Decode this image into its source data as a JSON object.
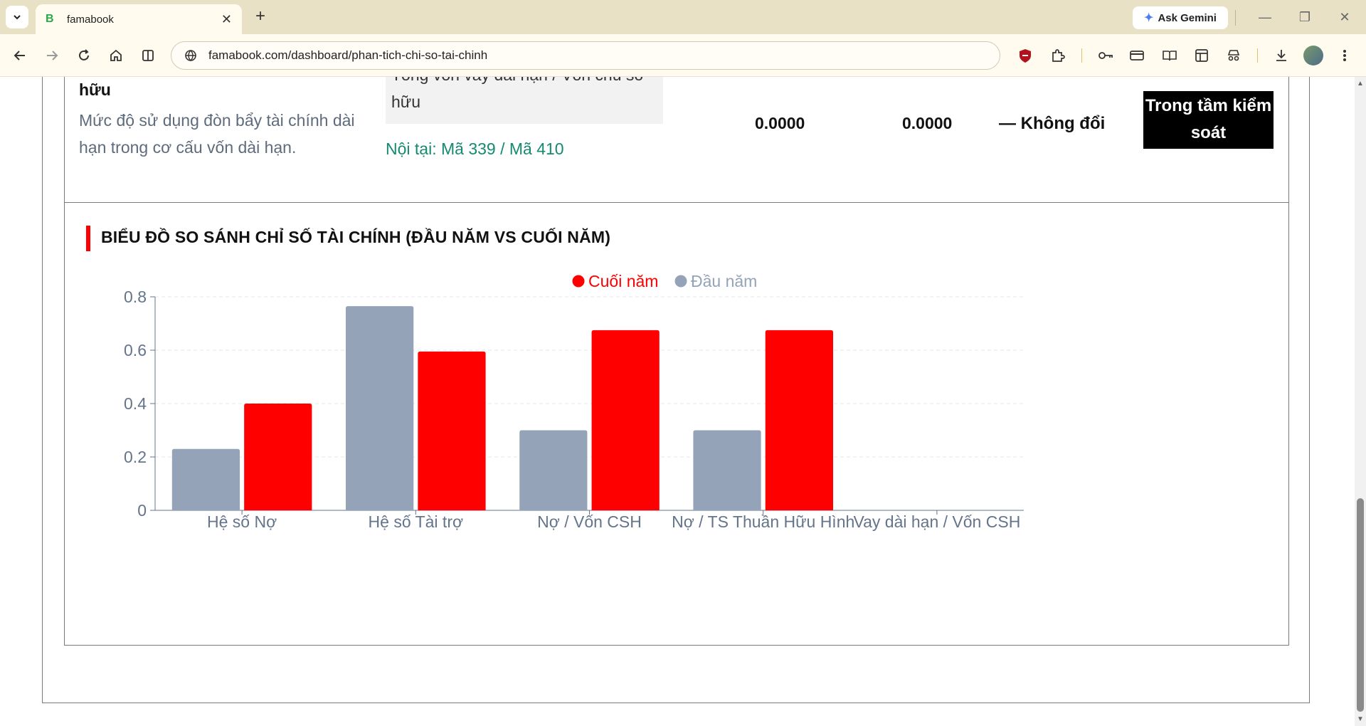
{
  "browser": {
    "tab_title": "famabook",
    "tab_favicon": "B",
    "url": "famabook.com/dashboard/phan-tich-chi-so-tai-chinh",
    "gemini_label": "Ask Gemini"
  },
  "ratio_row": {
    "name": "hữu",
    "description": "Mức độ sử dụng đòn bẩy tài chính dài hạn trong cơ cấu vốn dài hạn.",
    "formula": "Tổng vốn vay dài hạn / Vốn chủ sở hữu",
    "formula_code": "Nội tại: Mã 339 / Mã 410",
    "value_begin": "0.0000",
    "value_end": "0.0000",
    "change": "— Không đổi",
    "status": "Trong tầm kiểm soát"
  },
  "chart_data": {
    "type": "bar",
    "title": "BIỂU ĐỒ SO SÁNH CHỈ SỐ TÀI CHÍNH (ĐẦU NĂM VS CUỐI NĂM)",
    "categories": [
      "Hệ số Nợ",
      "Hệ số Tài trợ",
      "Nợ / Vốn CSH",
      "Nợ / TS Thuần Hữu Hình",
      "Vay dài hạn / Vốn CSH"
    ],
    "series": [
      {
        "name": "Đầu năm",
        "color": "#94a3b8",
        "values": [
          0.23,
          0.765,
          0.3,
          0.3,
          0
        ]
      },
      {
        "name": "Cuối năm",
        "color": "#ff0000",
        "values": [
          0.4,
          0.595,
          0.675,
          0.675,
          0
        ]
      }
    ],
    "legend_order": [
      "Cuối năm",
      "Đầu năm"
    ],
    "y_ticks": [
      "0",
      "0.2",
      "0.4",
      "0.6",
      "0.8"
    ],
    "ylim": [
      0,
      0.8
    ],
    "grid": true,
    "legend_position": "top-center"
  }
}
